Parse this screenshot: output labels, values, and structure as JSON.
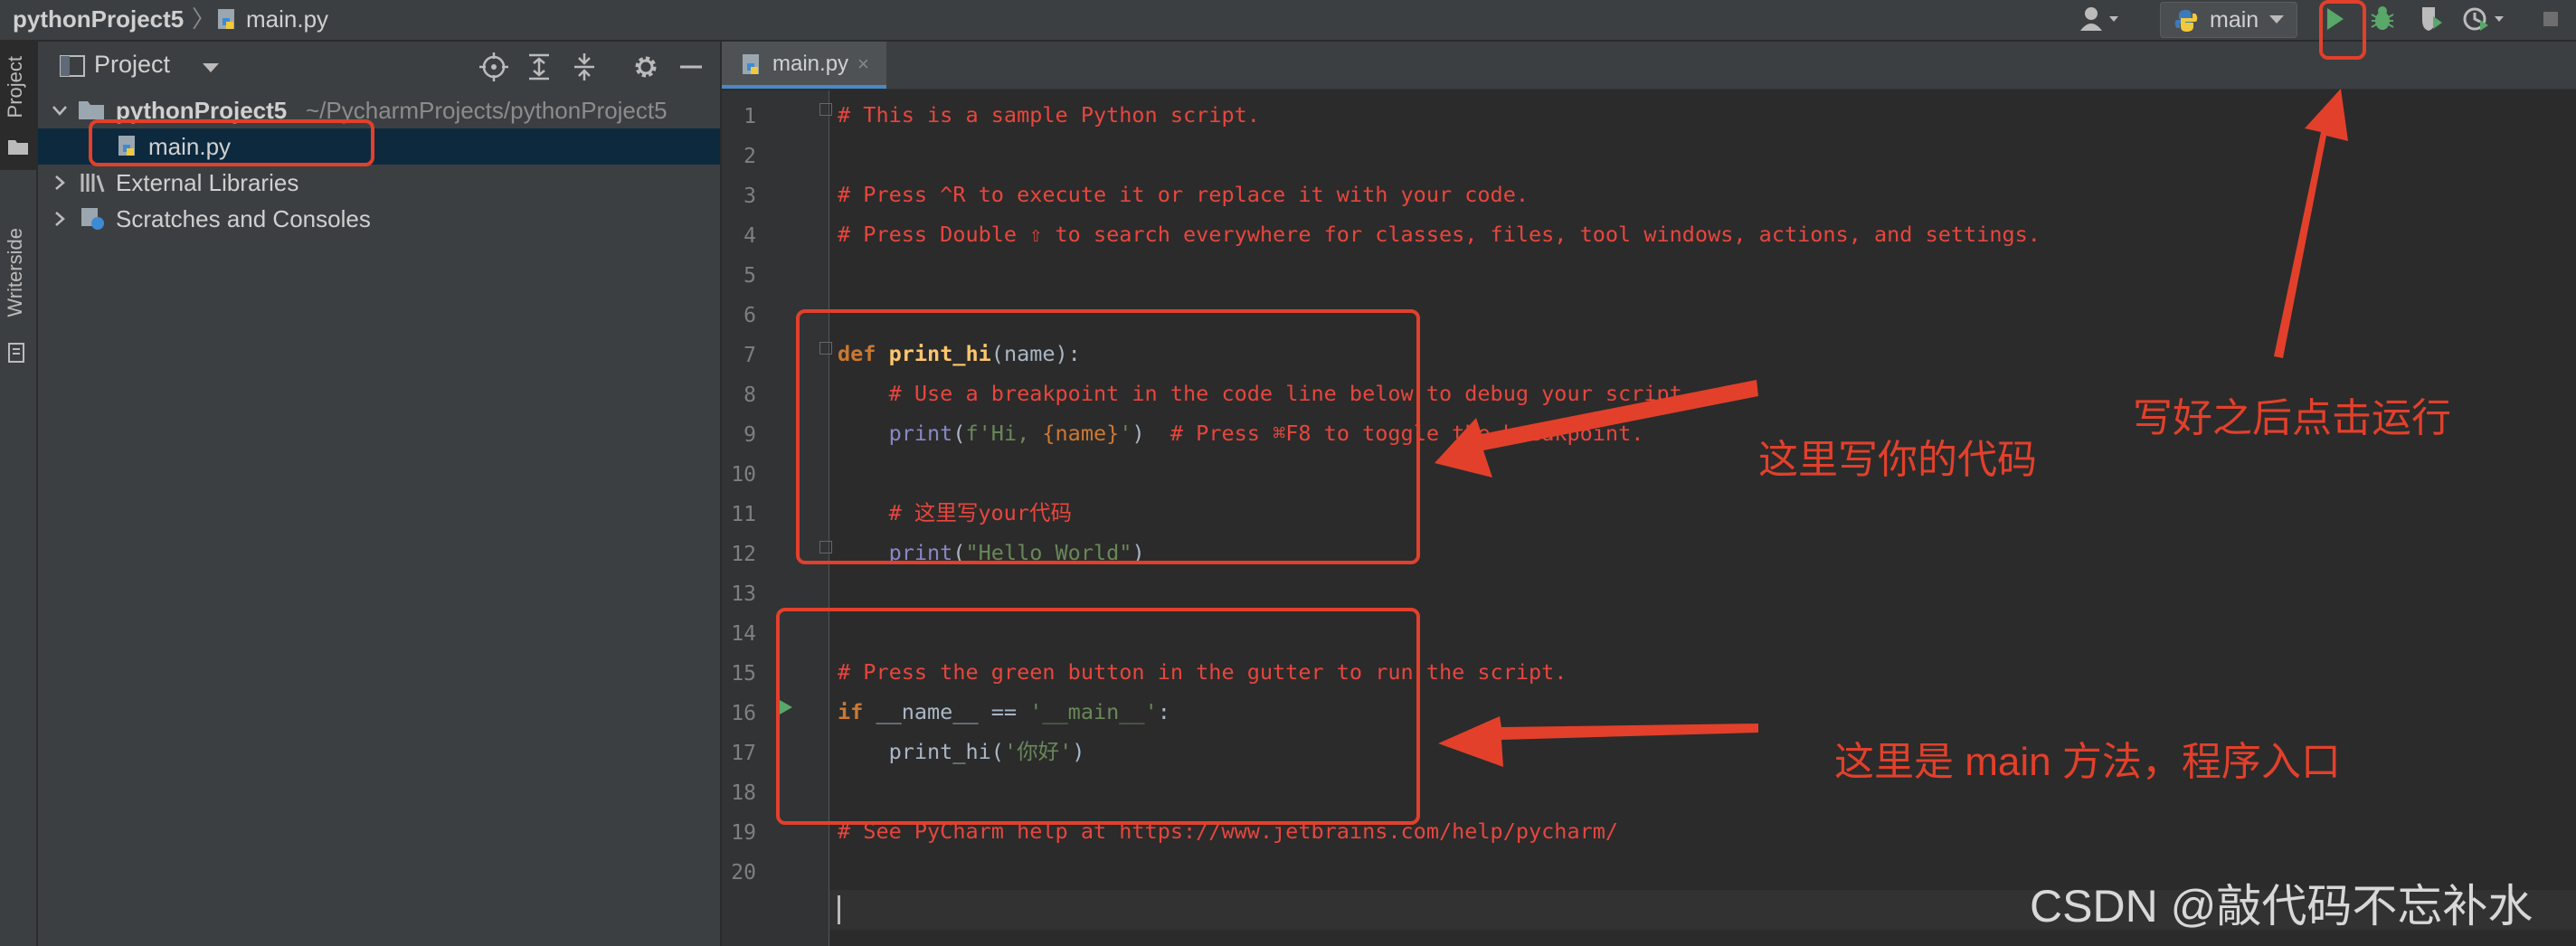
{
  "breadcrumb": {
    "project": "pythonProject5",
    "separator": "〉",
    "file": "main.py"
  },
  "toolbar": {
    "run_config": "main",
    "icons": [
      "user-icon",
      "python-icon",
      "run-icon",
      "debug-icon",
      "coverage-icon",
      "profile-icon",
      "stop-icon"
    ]
  },
  "side_tabs": {
    "project": "Project",
    "writerside": "Writerside"
  },
  "project_panel": {
    "title": "Project",
    "tree": {
      "root_name": "pythonProject5",
      "root_path": "~/PycharmProjects/pythonProject5",
      "file": "main.py",
      "external": "External Libraries",
      "scratches": "Scratches and Consoles"
    }
  },
  "editor": {
    "tab_label": "main.py",
    "tab_close": "×",
    "line_numbers": [
      "1",
      "2",
      "3",
      "4",
      "5",
      "6",
      "7",
      "8",
      "9",
      "10",
      "11",
      "12",
      "13",
      "14",
      "15",
      "16",
      "17",
      "18",
      "19",
      "20"
    ],
    "code": {
      "l1": "# This is a sample Python script.",
      "l3": "# Press ^R to execute it or replace it with your code.",
      "l4": "# Press Double ⇧ to search everywhere for classes, files, tool windows, actions, and settings.",
      "l7_kw": "def",
      "l7_fn": "print_hi",
      "l7_rest": "(name):",
      "l8": "# Use a breakpoint in the code line below to debug your script.",
      "l9_fn": "print",
      "l9_p1": "(",
      "l9_s1": "f'Hi, ",
      "l9_p2": "{name}",
      "l9_s2": "'",
      "l9_p3": ")",
      "l9_cm": "# Press ⌘F8 to toggle the breakpoint.",
      "l11": "# 这里写your代码",
      "l12_fn": "print",
      "l12_p1": "(",
      "l12_s": "\"Hello World\"",
      "l12_p2": ")",
      "l15": "# Press the green button in the gutter to run the script.",
      "l16_kw": "if",
      "l16_p1": " __name__ == ",
      "l16_s": "'__main__'",
      "l16_p2": ":",
      "l17_p1": "print_hi(",
      "l17_s": "'你好'",
      "l17_p2": ")",
      "l19": "# See PyCharm help at https://www.jetbrains.com/help/pycharm/"
    }
  },
  "annotations": {
    "write_code": "这里写你的代码",
    "run_after": "写好之后点击运行",
    "main_entry": "这里是 main 方法，程序入口"
  },
  "watermark": "CSDN @敲代码不忘补水",
  "colors": {
    "annotation": "#e2402b",
    "comment": "#e8463d",
    "keyword": "#cc7832",
    "function": "#ffc66d",
    "string": "#6a8759",
    "selection": "#0d293e"
  }
}
